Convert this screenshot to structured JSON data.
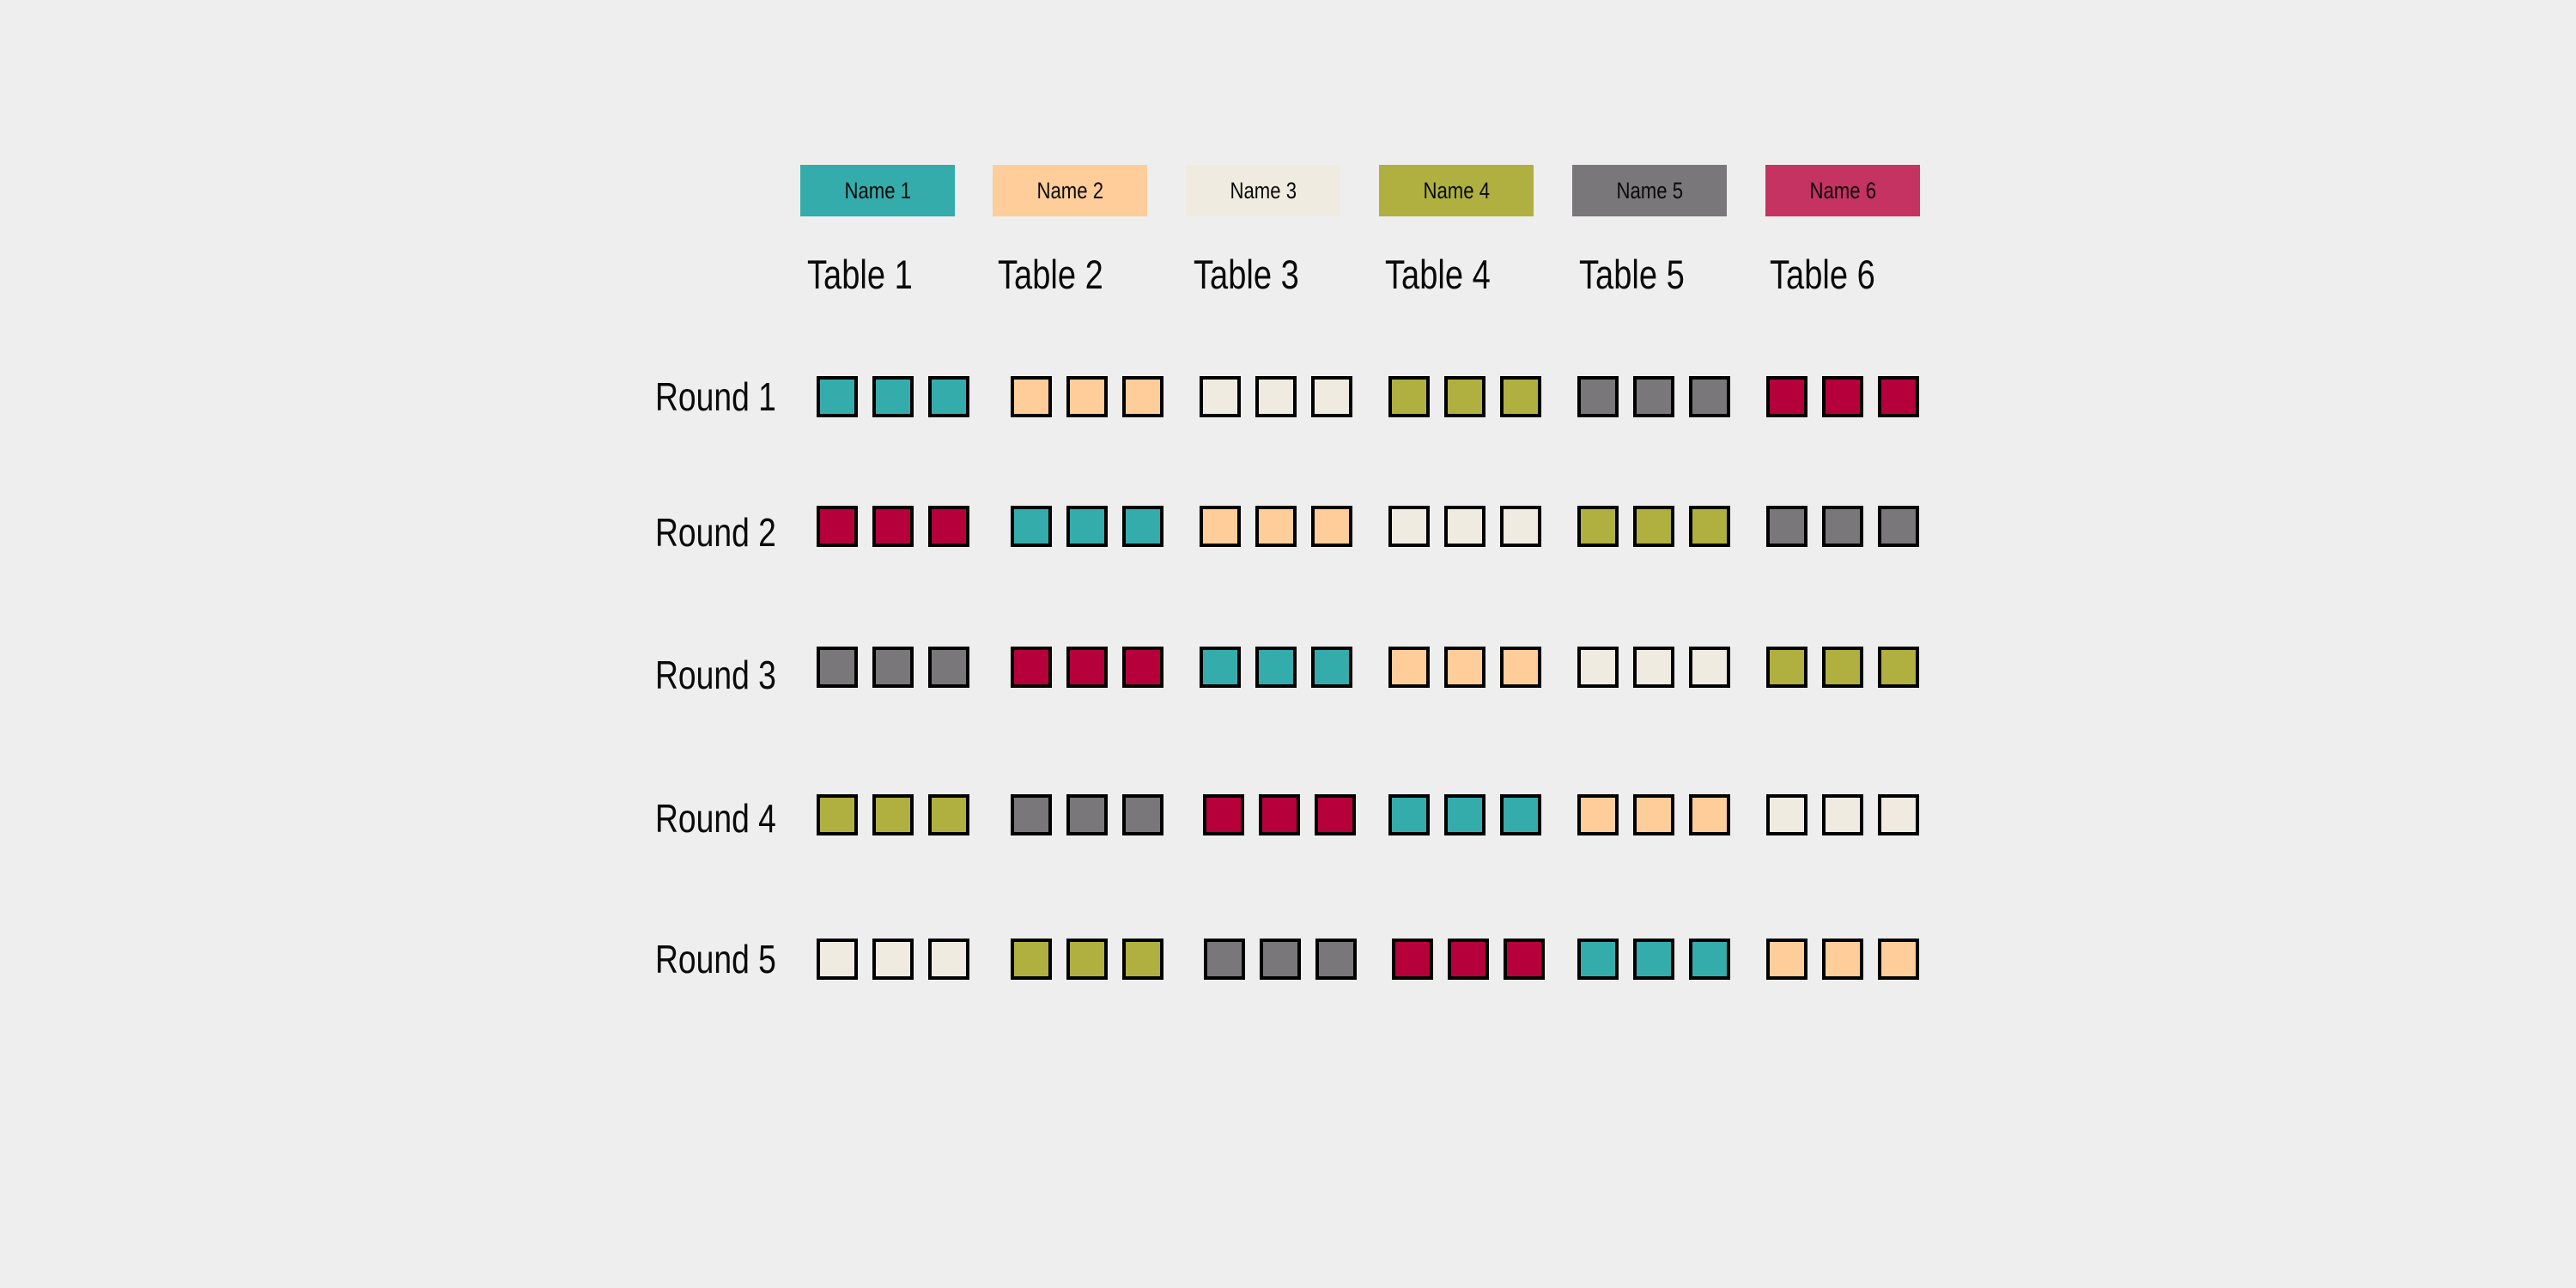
{
  "names": [
    {
      "label": "Name 1",
      "color": "#34acab"
    },
    {
      "label": "Name 2",
      "color": "#fecd9a"
    },
    {
      "label": "Name 3",
      "color": "#f0ebe0"
    },
    {
      "label": "Name 4",
      "color": "#b0b040"
    },
    {
      "label": "Name 5",
      "color": "#79777a"
    },
    {
      "label": "Name 6",
      "color": "#c43362"
    }
  ],
  "seat_colors": [
    "#34acab",
    "#fecd9a",
    "#f0ebe0",
    "#b0b040",
    "#79777a",
    "#b5003c"
  ],
  "tables": [
    "Table 1",
    "Table 2",
    "Table 3",
    "Table 4",
    "Table 5",
    "Table 6"
  ],
  "rounds": [
    {
      "label": "Round 1",
      "assignment": [
        1,
        2,
        3,
        4,
        5,
        6
      ]
    },
    {
      "label": "Round 2",
      "assignment": [
        6,
        1,
        2,
        3,
        4,
        5
      ]
    },
    {
      "label": "Round 3",
      "assignment": [
        5,
        6,
        1,
        2,
        3,
        4
      ]
    },
    {
      "label": "Round 4",
      "assignment": [
        4,
        5,
        6,
        1,
        2,
        3
      ]
    },
    {
      "label": "Round 5",
      "assignment": [
        3,
        4,
        5,
        6,
        1,
        2
      ]
    }
  ],
  "seats_per_table": 3
}
